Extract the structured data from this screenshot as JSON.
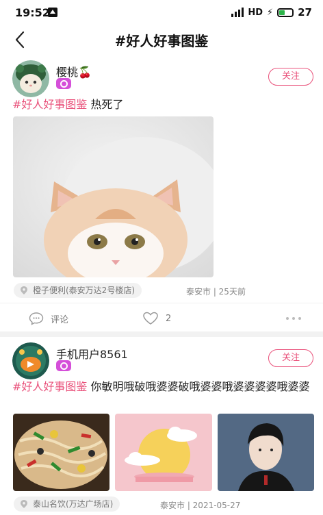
{
  "status_bar": {
    "time": "19:52",
    "network": "HD",
    "battery": "27",
    "icons": [
      "upload-icon",
      "signal-icon",
      "wifi-icon",
      "charging-icon",
      "battery-icon"
    ]
  },
  "header": {
    "title": "#好人好事图鉴",
    "back_icon": "chevron-left-icon"
  },
  "posts": [
    {
      "username": "樱桃🍒",
      "follow_label": "关注",
      "hashtag": "#好人好事图鉴",
      "text": " 热死了",
      "location": "橙子便利(泰安万达2号楼店)",
      "meta": "泰安市 | 25天前",
      "comment_label": "评论",
      "like_count": "2",
      "images": [
        "white-orange-kitten-photo"
      ]
    },
    {
      "username": "手机用户8561",
      "follow_label": "关注",
      "hashtag": "#好人好事图鉴",
      "text": " 你敏明哦破哦婆婆破哦婆婆哦婆婆婆婆哦婆婆",
      "location": "泰山名饮(万达广场店)",
      "meta": "泰安市 | 2021-05-27",
      "images": [
        "stir-fried-noodles-photo",
        "pink-sun-cloud-photo",
        "young-man-portrait-photo"
      ]
    }
  ],
  "colors": {
    "accent": "#e9507a",
    "badge": "#d54fd9",
    "text": "#222222",
    "muted": "#888888"
  }
}
